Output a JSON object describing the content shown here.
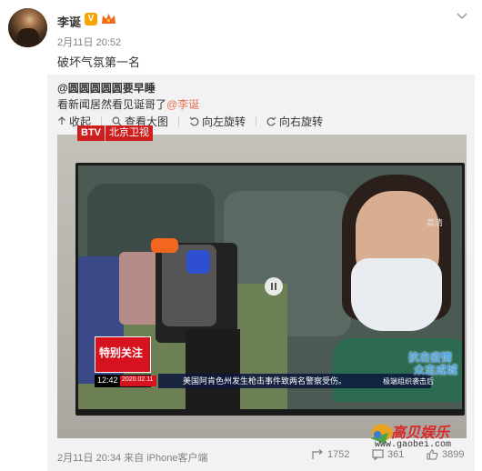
{
  "post": {
    "author": "李诞",
    "verified_badge": "V",
    "time": "2月11日 20:52",
    "text": "破坏气氛第一名"
  },
  "repost": {
    "author": "@圆圆圆圆圆要早睡",
    "text": "看新闻居然看见诞哥了",
    "mention": "@李诞"
  },
  "toolbar": {
    "collapse": "收起",
    "view_large": "查看大图",
    "rotate_left": "向左旋转",
    "rotate_right": "向右旋转"
  },
  "tv": {
    "logo": "BTV",
    "channel": "北京卫视",
    "hd": "高清",
    "special_focus": "特别关注",
    "clock": "12:42",
    "date": "2020.02.11",
    "ticker": "美国阿肯色州发生枪击事件致两名警察受伤。",
    "ticker_right": "极端组织袭击后",
    "epidemic_line1": "抗击疫情",
    "epidemic_line2": "众志成城"
  },
  "watermark": {
    "name": "高贝娱乐",
    "url": "www.gaobei.com"
  },
  "footer": {
    "time_source": "2月11日 20:34 来自 iPhone客户端",
    "reposts": "1752",
    "comments": "361",
    "likes": "3899"
  },
  "colors": {
    "link": "#eb7350",
    "repost_bg": "#f2f2f5",
    "badge": "#f7a300"
  }
}
